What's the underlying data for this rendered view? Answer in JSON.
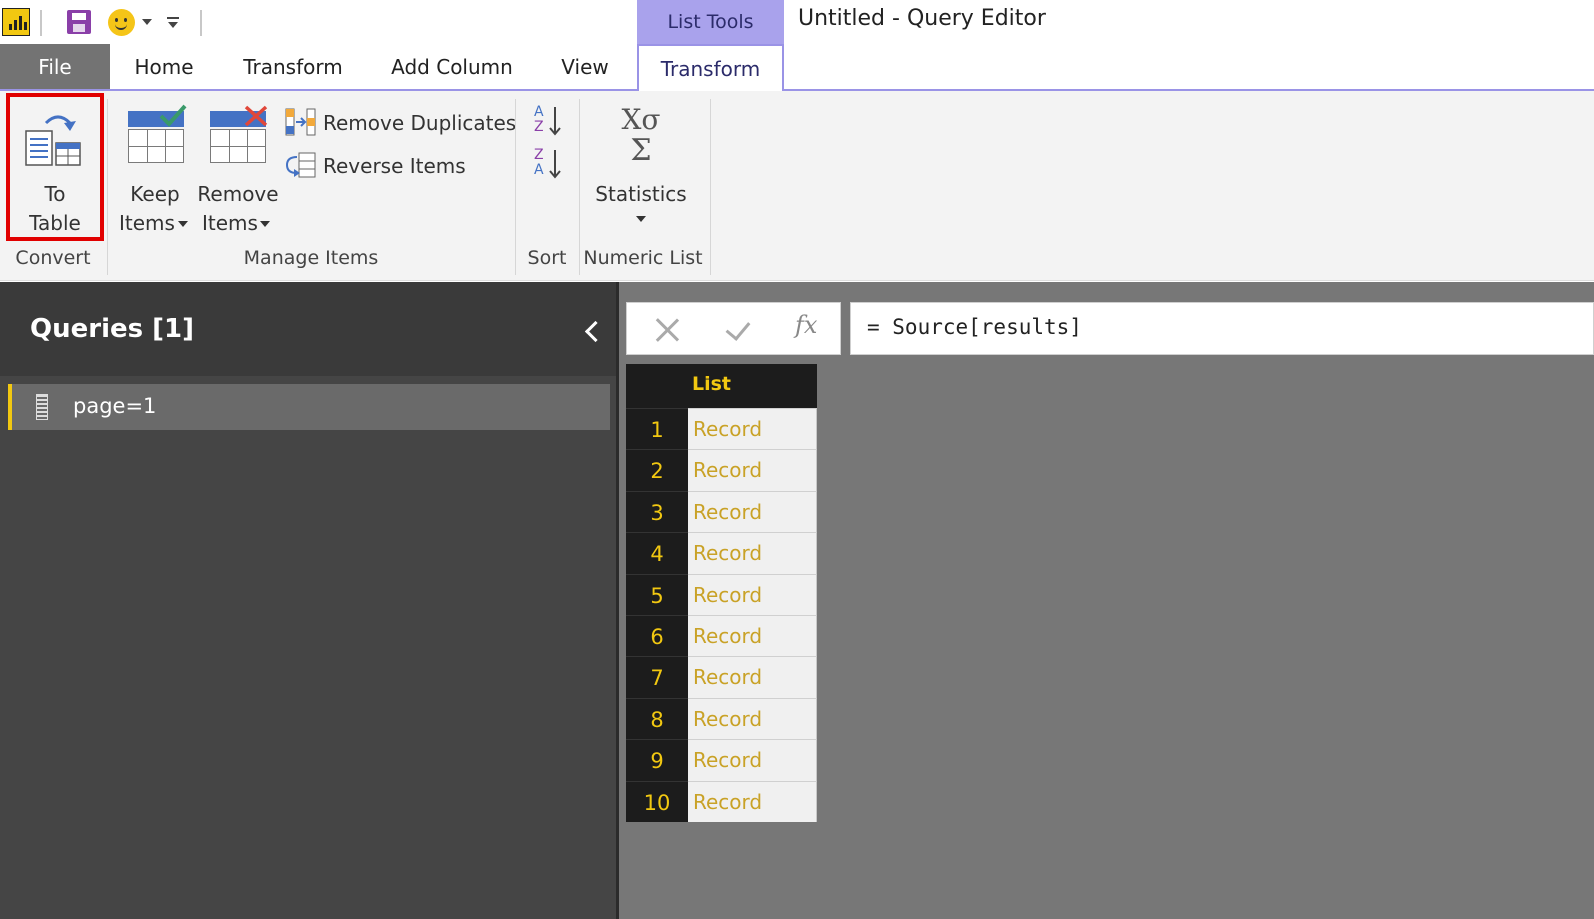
{
  "title_bar": {
    "context_tab_group": "List Tools",
    "window_title": "Untitled - Query Editor"
  },
  "ribbon_tabs": {
    "file": "File",
    "home": "Home",
    "transform": "Transform",
    "add_column": "Add Column",
    "view": "View",
    "list_transform": "Transform"
  },
  "ribbon": {
    "to_table": [
      "To",
      "Table"
    ],
    "keep_items": [
      "Keep",
      "Items"
    ],
    "remove_items": [
      "Remove",
      "Items"
    ],
    "remove_duplicates": "Remove Duplicates",
    "reverse_items": "Reverse Items",
    "statistics": "Statistics",
    "groups": {
      "convert": "Convert",
      "manage_items": "Manage Items",
      "sort": "Sort",
      "numeric_list": "Numeric List"
    },
    "sort_icons": {
      "asc_top": "A",
      "asc_bottom": "Z",
      "desc_top": "Z",
      "desc_bottom": "A"
    },
    "stats_icon": {
      "top": "Xσ",
      "bottom": "Σ"
    }
  },
  "queries": {
    "title": "Queries [1]",
    "items": [
      {
        "name": "page=1"
      }
    ]
  },
  "formula_bar": {
    "fx": "fx",
    "text": "= Source[results]"
  },
  "grid": {
    "column": "List",
    "rows": [
      {
        "num": "1",
        "value": "Record"
      },
      {
        "num": "2",
        "value": "Record"
      },
      {
        "num": "3",
        "value": "Record"
      },
      {
        "num": "4",
        "value": "Record"
      },
      {
        "num": "5",
        "value": "Record"
      },
      {
        "num": "6",
        "value": "Record"
      },
      {
        "num": "7",
        "value": "Record"
      },
      {
        "num": "8",
        "value": "Record"
      },
      {
        "num": "9",
        "value": "Record"
      },
      {
        "num": "10",
        "value": "Record"
      }
    ]
  },
  "colors": {
    "accent_yellow": "#f2c811",
    "context_tab": "#a9a2ec",
    "highlight_red": "#e10000"
  }
}
